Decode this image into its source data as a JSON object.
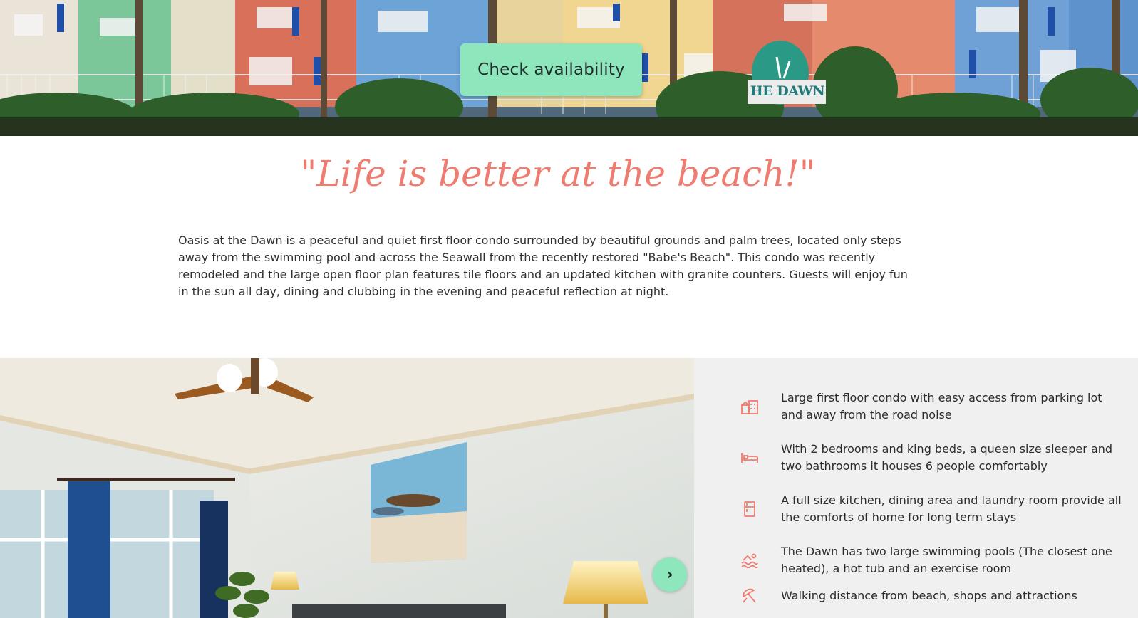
{
  "hero": {
    "cta_label": "Check availability",
    "sign_text": "HE DAWN"
  },
  "quote": "\"Life is better at the beach!\"",
  "intro": "Oasis at the Dawn is a peaceful and quiet first floor condo surrounded by beautiful grounds and palm trees, located only steps away from the swimming pool and across the Seawall from the recently restored \"Babe's Beach\". This condo was recently remodeled and the large open floor plan features tile floors and an updated kitchen with granite counters. Guests will enjoy fun in the sun all day, dining and clubbing in the evening and peaceful reflection at night.",
  "gallery": {
    "next_label": "›"
  },
  "features": [
    {
      "icon": "building-icon",
      "text": "Large first floor condo with easy access from parking lot and away from the road noise"
    },
    {
      "icon": "bed-icon",
      "text": "With 2 bedrooms and king beds, a queen size sleeper and two bathrooms it houses 6 people comfortably"
    },
    {
      "icon": "refrigerator-icon",
      "text": "A full size kitchen, dining area and laundry room provide all the comforts of home for long term stays"
    },
    {
      "icon": "swimming-pool-icon",
      "text": "The Dawn has two large swimming pools (The closest one heated), a hot tub and an exercise room"
    },
    {
      "icon": "beach-umbrella-icon",
      "text": "Walking distance from beach, shops and attractions"
    }
  ],
  "colors": {
    "accent": "#ef7c70",
    "button": "#8ee6bd",
    "features_bg": "#f0f0f0"
  }
}
